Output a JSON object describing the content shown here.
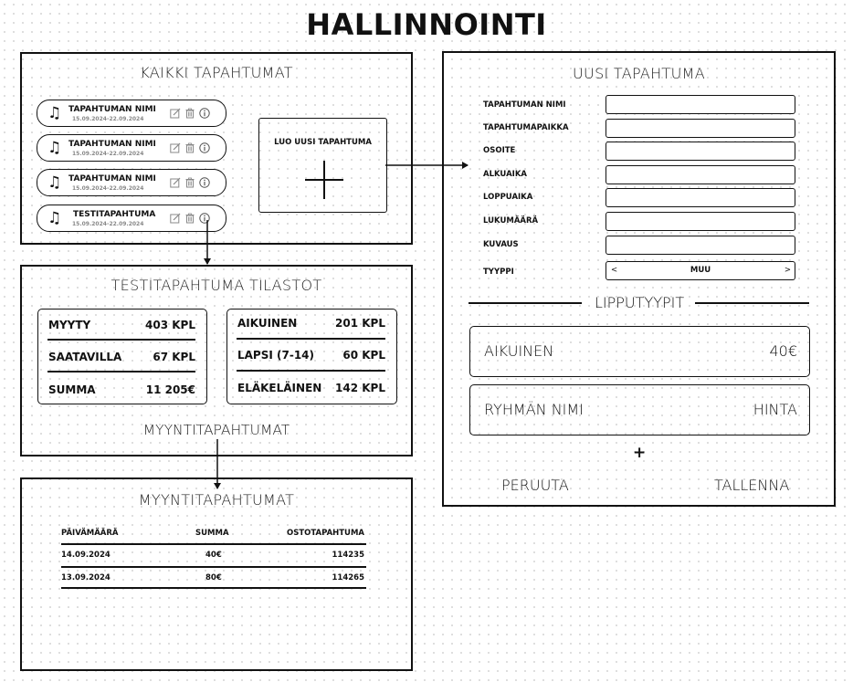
{
  "page_title": "HALLINNOINTI",
  "events_panel": {
    "title": "KAIKKI TAPAHTUMAT",
    "events": [
      {
        "name": "TAPAHTUMAN NIMI",
        "date": "15.09.2024-22.09.2024"
      },
      {
        "name": "TAPAHTUMAN NIMI",
        "date": "15.09.2024-22.09.2024"
      },
      {
        "name": "TAPAHTUMAN NIMI",
        "date": "15.09.2024-22.09.2024"
      },
      {
        "name": "TESTITAPAHTUMA",
        "date": "15.09.2024-22.09.2024"
      }
    ],
    "create_label": "LUO UUSI TAPAHTUMA",
    "icons": {
      "note": "music-note-icon",
      "edit": "edit-icon",
      "delete": "trash-icon",
      "info": "info-icon"
    }
  },
  "stats_panel": {
    "title": "TESTITAPAHTUMA TILASTOT",
    "left": [
      {
        "label": "MYYTY",
        "value": "403 KPL"
      },
      {
        "label": "SAATAVILLA",
        "value": "67 KPL"
      },
      {
        "label": "SUMMA",
        "value": "11 205€"
      }
    ],
    "right": [
      {
        "label": "AIKUINEN",
        "value": "201 KPL"
      },
      {
        "label": "LAPSI (7-14)",
        "value": "60 KPL"
      },
      {
        "label": "ELÄKELÄINEN",
        "value": "142 KPL"
      }
    ],
    "link_label": "MYYNTITAPAHTUMAT"
  },
  "sales_panel": {
    "title": "MYYNTITAPAHTUMAT",
    "columns": [
      "PÄIVÄMÄÄRÄ",
      "SUMMA",
      "OSTOTAPAHTUMA"
    ],
    "rows": [
      [
        "14.09.2024",
        "40€",
        "114235"
      ],
      [
        "13.09.2024",
        "80€",
        "114265"
      ]
    ]
  },
  "new_event_panel": {
    "title": "UUSI TAPAHTUMA",
    "fields": [
      "TAPAHTUMAN NIMI",
      "TAPAHTUMAPAIKKA",
      "OSOITE",
      "ALKUAIKA",
      "LOPPUAIKA",
      "LUKUMÄÄRÄ",
      "KUVAUS"
    ],
    "type_label": "TYYPPI",
    "type_value": "MUU",
    "type_prev": "<",
    "type_next": ">",
    "ticket_types_label": "LIPPUTYYPIT",
    "tickets": [
      {
        "name": "AIKUINEN",
        "price": "40€"
      },
      {
        "name": "RYHMÄN NIMI",
        "price": "HINTA"
      }
    ],
    "add_label": "+",
    "cancel_label": "PERUUTA",
    "save_label": "TALLENNA"
  }
}
